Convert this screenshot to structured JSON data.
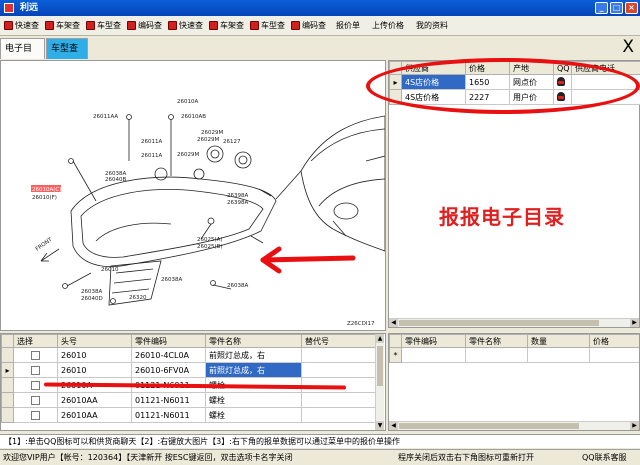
{
  "window": {
    "title": "利远",
    "minimize": "_",
    "maximize": "□",
    "close": "×"
  },
  "toolbar": [
    {
      "label": "快速查",
      "icon": "tool-icon"
    },
    {
      "label": "车架查",
      "icon": "tool-icon"
    },
    {
      "label": "车型查",
      "icon": "tool-icon"
    },
    {
      "label": "编码查",
      "icon": "tool-icon"
    },
    {
      "label": "快速查",
      "icon": "tool-icon"
    },
    {
      "label": "车架查",
      "icon": "tool-icon"
    },
    {
      "label": "车型查",
      "icon": "tool-icon"
    },
    {
      "label": "编码查",
      "icon": "tool-icon"
    },
    {
      "label": "报价单",
      "icon": ""
    },
    {
      "label": "上传价格",
      "icon": ""
    },
    {
      "label": "我的资料",
      "icon": ""
    }
  ],
  "tabs": {
    "catalog": "电子目录",
    "model": "车型查"
  },
  "big_close": "X",
  "diagram": {
    "labels": [
      "26010A",
      "26011AA",
      "26010AB",
      "26029M",
      "26029M",
      "26127",
      "26011A",
      "26011A",
      "26029M",
      "26398A",
      "26398A",
      "26010A(C)",
      "26010(F)",
      "26025(A)",
      "26025(B)",
      "26038A",
      "26040B",
      "26038A",
      "26320",
      "26038A",
      "26040D",
      "26038A",
      "26010"
    ],
    "front_label": "FRONT",
    "code": "Z26CDI17"
  },
  "supplier": {
    "columns": [
      "供应商",
      "价格",
      "产地",
      "QQ",
      "供应商电话"
    ],
    "rows": [
      {
        "supplier": "4S店价格",
        "price": "1650",
        "origin": "网点价",
        "qq": "qq-icon",
        "phone": ""
      },
      {
        "supplier": "4S店价格",
        "price": "2227",
        "origin": "用户价",
        "qq": "qq-icon",
        "phone": ""
      }
    ],
    "promo": "报报电子目录"
  },
  "parts": {
    "columns": [
      "选择",
      "头号",
      "零件编码",
      "零件名称",
      "替代号"
    ],
    "rows": [
      {
        "head": "26010",
        "code": "26010-4CL0A",
        "name": "前照灯总成，右",
        "alt": ""
      },
      {
        "head": "26010",
        "code": "26010-6FV0A",
        "name": "前照灯总成，右",
        "alt": ""
      },
      {
        "head": "26010A",
        "code": "01121-N6011",
        "name": "螺栓",
        "alt": ""
      },
      {
        "head": "26010AA",
        "code": "01121-N6011",
        "name": "螺栓",
        "alt": ""
      },
      {
        "head": "26010AA",
        "code": "01121-N6011",
        "name": "螺栓",
        "alt": ""
      }
    ]
  },
  "detail": {
    "columns": [
      "零件编码",
      "零件名称",
      "数量",
      "价格"
    ],
    "new_row_marker": "*"
  },
  "tip": "【1】:单击QQ图标可以和供货商聊天【2】:右键放大图片【3】:右下角的报单数据可以通过菜单中的报价单操作",
  "status": {
    "welcome": "欢迎您VIP用户【帐号：120364】【天津新开 按ESC键返回，双击选项卡名字关闭",
    "hint": "程序关闭后双击右下角图标可重新打开",
    "contact": "QQ联系客服"
  }
}
